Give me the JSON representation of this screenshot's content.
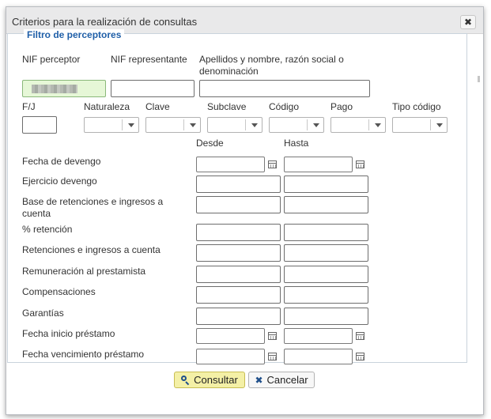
{
  "dialog": {
    "title": "Criterios para la realización de consultas",
    "close_icon": "close-icon",
    "legend": "Filtro de perceptores"
  },
  "top_fields": {
    "nif_perceptor": "NIF perceptor",
    "nif_representante": "NIF representante",
    "apellidos_line1": "Apellidos y nombre, razón social o",
    "apellidos_line2": "denominación"
  },
  "select_row": {
    "fj": "F/J",
    "naturaleza": "Naturaleza",
    "clave": "Clave",
    "subclave": "Subclave",
    "codigo": "Código",
    "pago": "Pago",
    "tipo_codigo": "Tipo código"
  },
  "range": {
    "desde": "Desde",
    "hasta": "Hasta",
    "rows": [
      {
        "label": "Fecha de devengo"
      },
      {
        "label": "Ejercicio devengo"
      },
      {
        "label": "Base de retenciones e ingresos a",
        "label2": "cuenta"
      },
      {
        "label": "% retención"
      },
      {
        "label": "Retenciones e ingresos a cuenta"
      },
      {
        "label": "Remuneración al prestamista"
      },
      {
        "label": "Compensaciones"
      },
      {
        "label": "Garantías"
      },
      {
        "label": "Fecha inicio préstamo"
      },
      {
        "label": "Fecha vencimiento préstamo"
      }
    ]
  },
  "buttons": {
    "consultar": "Consultar",
    "cancelar": "Cancelar",
    "consultar_icon": "search-icon",
    "cancelar_icon": "close-icon"
  }
}
